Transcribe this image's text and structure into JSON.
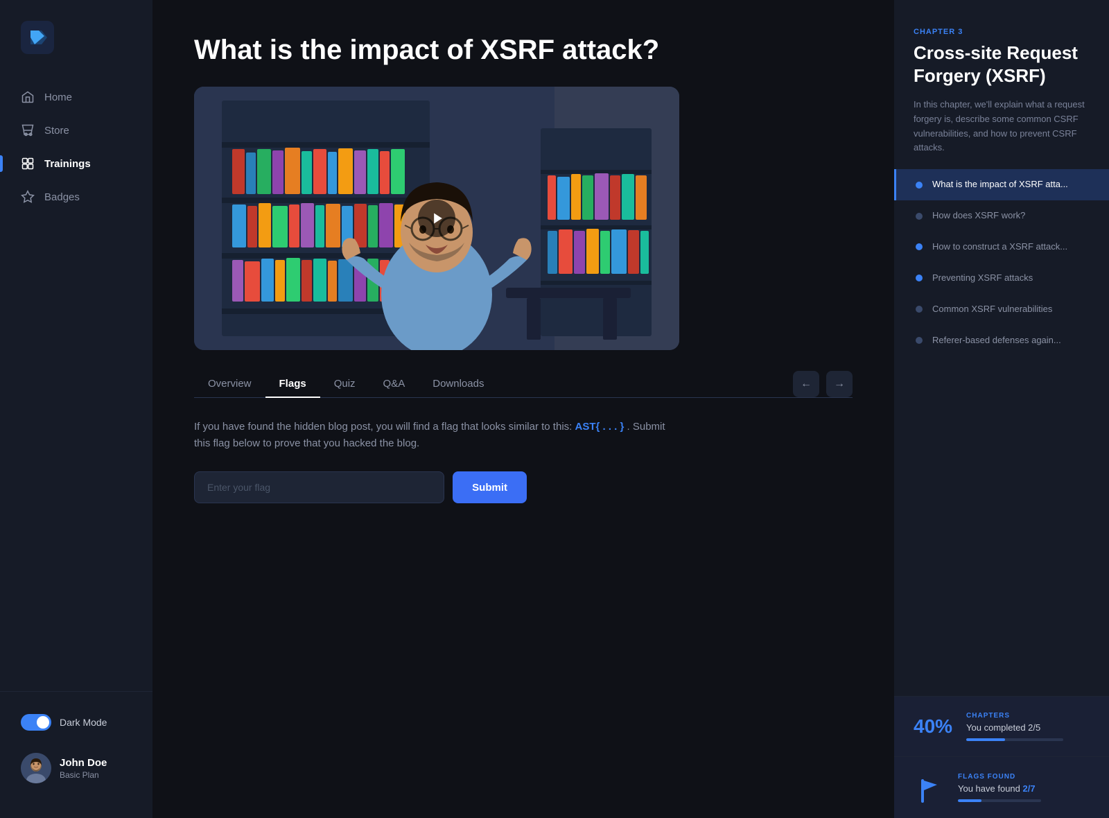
{
  "sidebar": {
    "logo_alt": "Logo",
    "nav_items": [
      {
        "label": "Home",
        "icon": "home-icon",
        "active": false
      },
      {
        "label": "Store",
        "icon": "store-icon",
        "active": false
      },
      {
        "label": "Trainings",
        "icon": "trainings-icon",
        "active": true
      },
      {
        "label": "Badges",
        "icon": "badges-icon",
        "active": false
      }
    ],
    "dark_mode_label": "Dark Mode",
    "user": {
      "name": "John Doe",
      "plan": "Basic Plan"
    }
  },
  "main": {
    "page_title": "What is the impact of XSRF attack?",
    "tabs": [
      {
        "label": "Overview",
        "active": false
      },
      {
        "label": "Flags",
        "active": true
      },
      {
        "label": "Quiz",
        "active": false
      },
      {
        "label": "Q&A",
        "active": false
      },
      {
        "label": "Downloads",
        "active": false
      }
    ],
    "flags_section": {
      "description": "If you have found the hidden blog post, you will find a flag that looks similar to this:",
      "flag_code": "AST{ . . . }",
      "description_suffix": ". Submit this flag below to prove that you hacked the blog.",
      "input_placeholder": "Enter your flag",
      "submit_label": "Submit"
    }
  },
  "right_sidebar": {
    "chapter_label": "CHAPTER 3",
    "chapter_title": "Cross-site Request Forgery (XSRF)",
    "chapter_desc": "In this chapter, we'll explain what a request forgery is, describe some common CSRF vulnerabilities, and how to prevent CSRF attacks.",
    "lessons": [
      {
        "label": "What is the impact of XSRF atta...",
        "active": true
      },
      {
        "label": "How does XSRF work?",
        "active": false
      },
      {
        "label": "How to construct a XSRF attack...",
        "active": false
      },
      {
        "label": "Preventing XSRF attacks",
        "active": false
      },
      {
        "label": "Common XSRF vulnerabilities",
        "active": false
      },
      {
        "label": "Referer-based defenses again...",
        "active": false
      }
    ],
    "progress": {
      "label": "CHAPTERS",
      "percentage": "40%",
      "text": "You completed 2/5",
      "fill_width": "40%"
    },
    "flags": {
      "label": "FLAGS FOUND",
      "text_prefix": "You have found",
      "highlight": "2/7",
      "fill_width": "28%"
    }
  }
}
